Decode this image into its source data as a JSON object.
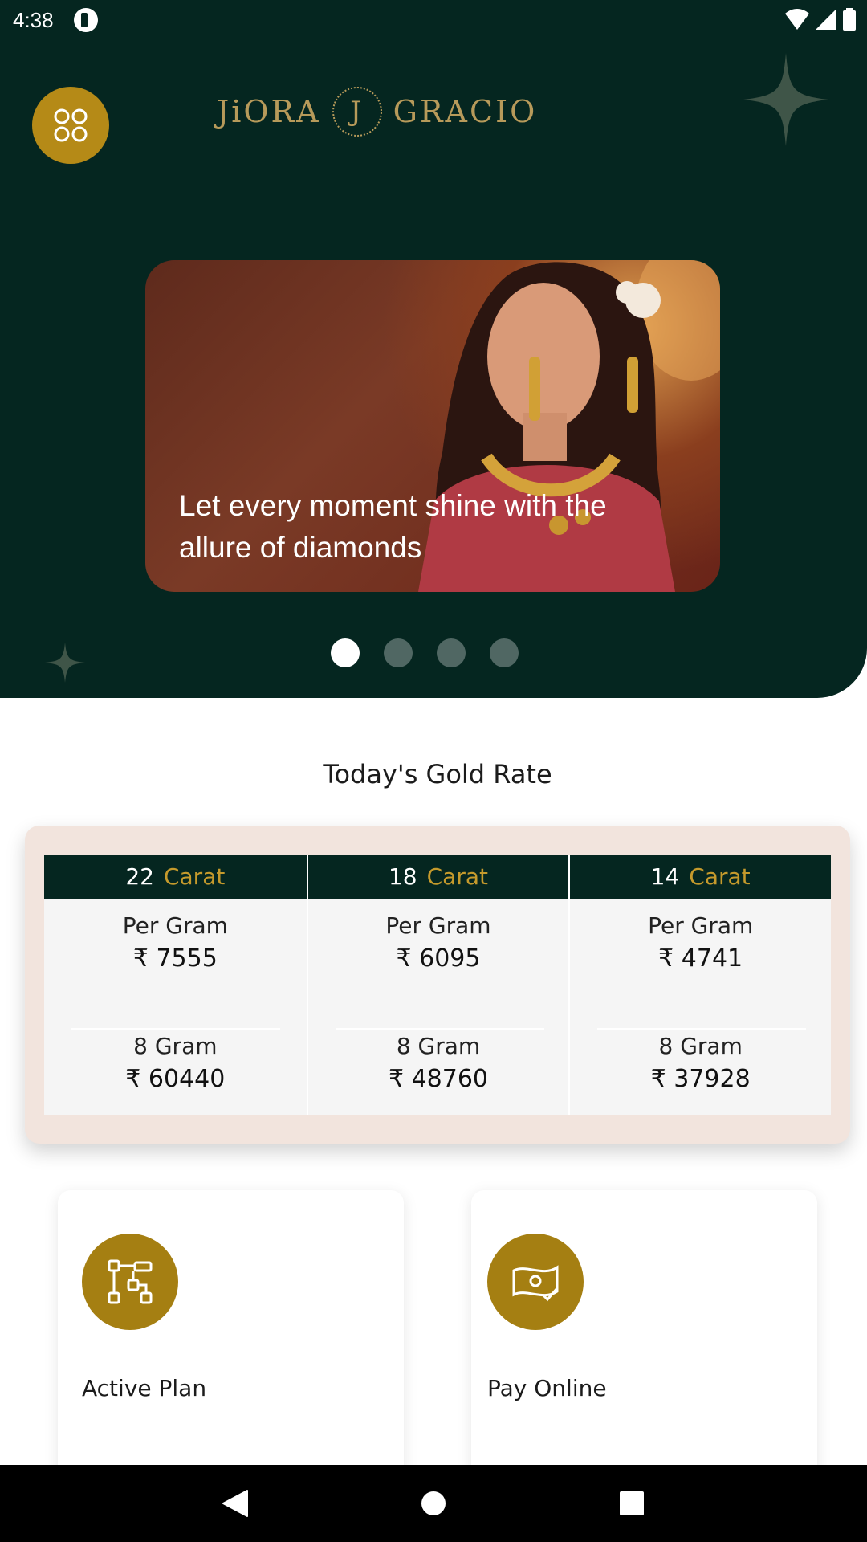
{
  "status_bar": {
    "time": "4:38"
  },
  "header": {
    "brand_left": "JiORA",
    "brand_monogram": "J",
    "brand_right": "GRACIO"
  },
  "banner": {
    "caption": "Let every moment shine with the allure of diamonds",
    "slide_count": 4,
    "active_slide": 1
  },
  "gold_rate": {
    "title": "Today's Gold Rate",
    "columns": [
      {
        "karat": "22",
        "unit": "Carat",
        "per_gram_label": "Per Gram",
        "per_gram": "₹ 7555",
        "eight_gram_label": "8 Gram",
        "eight_gram": "₹ 60440"
      },
      {
        "karat": "18",
        "unit": "Carat",
        "per_gram_label": "Per Gram",
        "per_gram": "₹ 6095",
        "eight_gram_label": "8 Gram",
        "eight_gram": "₹ 48760"
      },
      {
        "karat": "14",
        "unit": "Carat",
        "per_gram_label": "Per Gram",
        "per_gram": "₹ 4741",
        "eight_gram_label": "8 Gram",
        "eight_gram": "₹ 37928"
      }
    ]
  },
  "actions": [
    {
      "label": "Active Plan",
      "icon": "plan-flow-icon"
    },
    {
      "label": "Pay Online",
      "icon": "payment-check-icon"
    }
  ],
  "colors": {
    "primary_dark": "#052620",
    "gold": "#B58A17",
    "card_bg": "#F2E4DD"
  }
}
